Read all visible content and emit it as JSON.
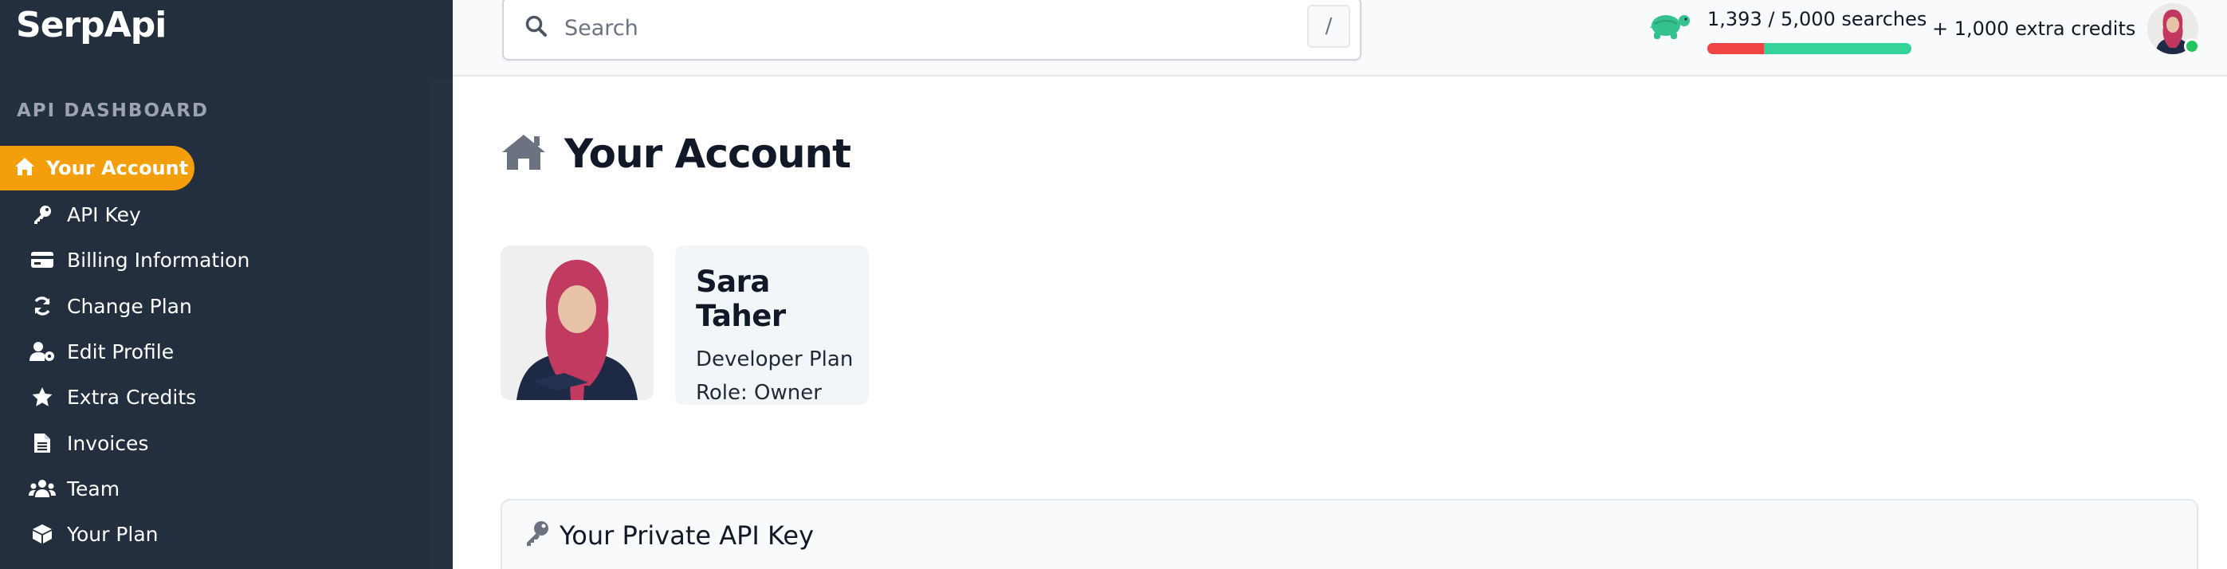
{
  "brand": "SerpApi",
  "sidebar": {
    "section_title": "API DASHBOARD",
    "items": [
      {
        "label": "Your Account",
        "icon": "home-icon",
        "active": true
      },
      {
        "label": "API Key",
        "icon": "key-icon"
      },
      {
        "label": "Billing Information",
        "icon": "credit-card-icon"
      },
      {
        "label": "Change Plan",
        "icon": "sync-icon"
      },
      {
        "label": "Edit Profile",
        "icon": "user-cog-icon"
      },
      {
        "label": "Extra Credits",
        "icon": "star-icon"
      },
      {
        "label": "Invoices",
        "icon": "file-icon"
      },
      {
        "label": "Team",
        "icon": "users-icon"
      },
      {
        "label": "Your Plan",
        "icon": "box-icon"
      }
    ]
  },
  "search": {
    "placeholder": "Search",
    "shortcut": "/"
  },
  "usage": {
    "text": "1,393 / 5,000 searches",
    "used": 1393,
    "total": 5000,
    "extra_credits": "+ 1,000 extra credits"
  },
  "main": {
    "title": "Your Account",
    "profile": {
      "name": "Sara Taher",
      "plan": "Developer Plan",
      "role": "Role: Owner"
    },
    "api_card_title": "Your Private API Key"
  },
  "colors": {
    "sidebar_bg": "#232f3e",
    "accent": "#f59e0b",
    "usage_used": "#ef4444",
    "usage_remaining": "#34d399",
    "turtle": "#34c38f",
    "online": "#22c55e"
  }
}
